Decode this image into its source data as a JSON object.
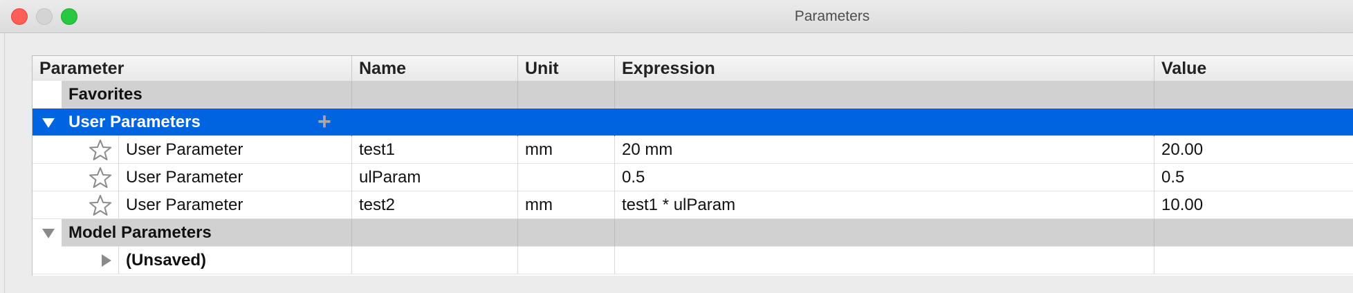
{
  "window": {
    "title": "Parameters"
  },
  "columns": [
    "Parameter",
    "Name",
    "Unit",
    "Expression",
    "Value"
  ],
  "groups": {
    "favorites": {
      "label": "Favorites"
    },
    "user": {
      "label": "User Parameters",
      "add_icon": "plus-icon"
    },
    "model": {
      "label": "Model Parameters"
    },
    "unsaved": {
      "label": "(Unsaved)"
    }
  },
  "rows": [
    {
      "parameter": "User Parameter",
      "name": "test1",
      "unit": "mm",
      "expression": "20 mm",
      "value": "20.00"
    },
    {
      "parameter": "User Parameter",
      "name": "ulParam",
      "unit": "",
      "expression": "0.5",
      "value": "0.5"
    },
    {
      "parameter": "User Parameter",
      "name": "test2",
      "unit": "mm",
      "expression": "test1 * ulParam",
      "value": "10.00"
    }
  ],
  "colors": {
    "selection": "#0064e1",
    "group_bg": "#d1d1d1"
  },
  "icons": {
    "favorite": "star-outline-icon"
  }
}
